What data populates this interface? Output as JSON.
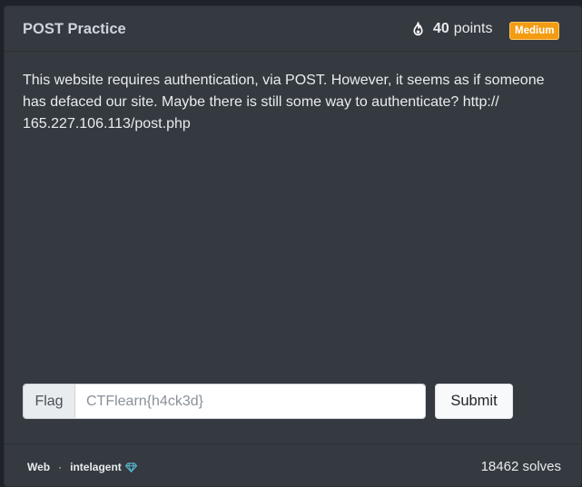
{
  "challenge": {
    "title": "POST Practice",
    "points_value": "40",
    "points_label": "points",
    "difficulty": "Medium",
    "description": "This website requires authentication, via POST. However, it seems as if someone has defaced our site. Maybe there is still some way to authenticate? http:// 165.227.106.113/post.php"
  },
  "form": {
    "flag_label": "Flag",
    "flag_placeholder": "CTFlearn{h4ck3d}",
    "submit_label": "Submit"
  },
  "footer": {
    "category": "Web",
    "separator": "·",
    "author": "intelagent",
    "solves": "18462 solves"
  },
  "colors": {
    "card_bg": "#343a40",
    "difficulty_badge": "#f39c12",
    "gem": "#5bc0de"
  },
  "icons": {
    "points": "flame-icon",
    "author_badge": "diamond-icon"
  }
}
